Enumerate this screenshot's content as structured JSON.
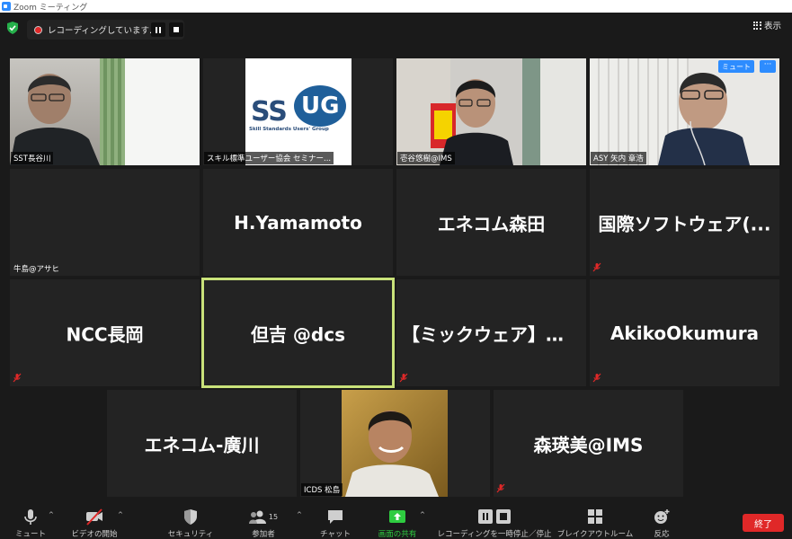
{
  "window": {
    "title": "Zoom ミーティング"
  },
  "topbar": {
    "recording_label": "レコーディングしています...",
    "view_label": "表示"
  },
  "tiles": [
    {
      "name": "SST長谷川",
      "kind": "video"
    },
    {
      "name": "スキル標準ユーザー協会 セミナー...",
      "kind": "logo",
      "logo_text": "SSUG",
      "logo_sub": "Skill Standards Users' Group"
    },
    {
      "name": "壱谷悠樹@IMS",
      "kind": "video"
    },
    {
      "name": "ASY 矢内 章浩",
      "kind": "video",
      "mute_label": "ミュート",
      "more_label": "···"
    },
    {
      "name": "牛島@アサヒ",
      "kind": "blank"
    },
    {
      "big_name": "H.Yamamoto",
      "kind": "name"
    },
    {
      "big_name": "エネコム森田",
      "kind": "name"
    },
    {
      "big_name": "国際ソフトウェア(...",
      "kind": "name",
      "muted": true
    },
    {
      "big_name": "NCC長岡",
      "kind": "name",
      "muted": true
    },
    {
      "big_name": "但吉 @dcs",
      "kind": "name",
      "active": true
    },
    {
      "big_name": "【ミックウェア】あお...",
      "kind": "name",
      "muted": true
    },
    {
      "big_name": "AkikoOkumura",
      "kind": "name",
      "muted": true
    },
    {
      "big_name": "エネコム-廣川",
      "kind": "name"
    },
    {
      "name": "ICDS 松島",
      "kind": "video"
    },
    {
      "big_name": "森瑛美@IMS",
      "kind": "name",
      "muted": true
    }
  ],
  "toolbar": {
    "mute": "ミュート",
    "video": "ビデオの開始",
    "security": "セキュリティ",
    "participants": "参加者",
    "participants_count": "15",
    "chat": "チャット",
    "share": "画面の共有",
    "record": "レコーディングを一時停止／停止",
    "breakout": "ブレイクアウトルーム",
    "reactions": "反応",
    "end": "終了",
    "share_color": "#2ecc40",
    "end_color": "#e02828"
  },
  "colors": {
    "active_border": "#c9e27a",
    "accent": "#2d8cff"
  }
}
